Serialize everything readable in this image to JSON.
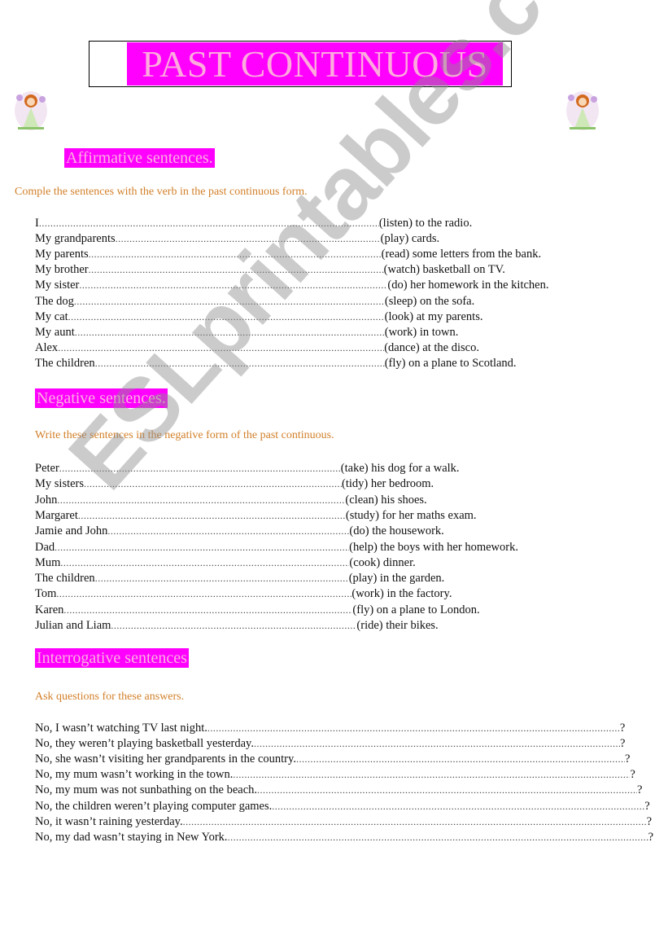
{
  "title": "PAST CONTINUOUS",
  "decorations": {
    "left_image": "fairy-girl-illustration",
    "right_image": "fairy-girl-illustration"
  },
  "colors": {
    "heading_bg": "#ff00ff",
    "heading_text": "#ffb0e0",
    "instruction_text": "#d2802a"
  },
  "watermark": "ESLprintables.com",
  "affirmative": {
    "heading": "Affirmative sentences.",
    "instruction": "Comple the sentences with the verb in the past continuous form.",
    "items": [
      {
        "subject": "I",
        "rest": "(listen) to the radio."
      },
      {
        "subject": "My grandparents",
        "rest": "(play) cards."
      },
      {
        "subject": "My parents",
        "rest": "(read) some letters from the bank."
      },
      {
        "subject": "My brother",
        "rest": "(watch) basketball on TV."
      },
      {
        "subject": "My sister",
        "rest": "(do) her homework in the kitchen."
      },
      {
        "subject": "The dog",
        "rest": "(sleep) on the sofa."
      },
      {
        "subject": "My cat",
        "rest": "(look) at my parents."
      },
      {
        "subject": "My aunt",
        "rest": "(work) in town."
      },
      {
        "subject": "Alex",
        "rest": "(dance) at the disco."
      },
      {
        "subject": "The children",
        "rest": "(fly) on a plane to Scotland."
      }
    ]
  },
  "negative": {
    "heading": "Negative sentences.",
    "instruction": "Write these sentences in the negative form of the past continuous.",
    "items": [
      {
        "subject": "Peter",
        "rest": "(take) his dog for a walk."
      },
      {
        "subject": "My sisters",
        "rest": "(tidy) her bedroom."
      },
      {
        "subject": "John",
        "rest": "(clean) his shoes."
      },
      {
        "subject": "Margaret",
        "rest": "(study) for her maths exam."
      },
      {
        "subject": "Jamie and John",
        "rest": "(do) the housework."
      },
      {
        "subject": "Dad",
        "rest": "(help) the boys with her homework."
      },
      {
        "subject": "Mum",
        "rest": "(cook) dinner."
      },
      {
        "subject": "The children",
        "rest": "(play) in the garden."
      },
      {
        "subject": "Tom",
        "rest": "(work) in the factory."
      },
      {
        "subject": "Karen",
        "rest": "(fly) on a plane to London."
      },
      {
        "subject": "Julian and Liam",
        "rest": "(ride) their bikes."
      }
    ]
  },
  "interrogative": {
    "heading": "Interrogative sentences",
    "instruction": "Ask questions for these answers.",
    "items": [
      {
        "answer": "No, I wasn’t watching TV last night.",
        "rest": "?"
      },
      {
        "answer": "No, they weren’t playing basketball yesterday.",
        "rest": "?"
      },
      {
        "answer": "No, she wasn’t visiting her grandparents in the country.",
        "rest": "?"
      },
      {
        "answer": "No, my mum wasn’t working in the town.",
        "rest": "?"
      },
      {
        "answer": "No, my mum was not sunbathing on the beach.",
        "rest": "?"
      },
      {
        "answer": "No, the children weren’t playing computer games.",
        "rest": "?"
      },
      {
        "answer": "No, it wasn’t raining yesterday.",
        "rest": "?"
      },
      {
        "answer": "No, my dad wasn’t staying in New York.",
        "rest": "?"
      }
    ]
  }
}
